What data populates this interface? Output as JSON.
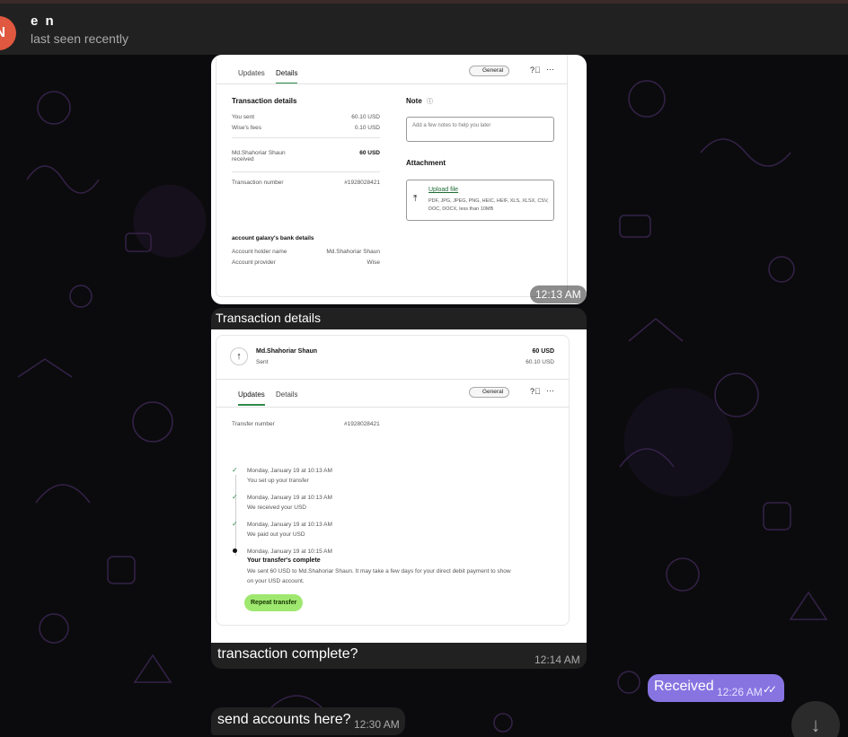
{
  "header": {
    "avatar_letter": "N",
    "peer_name": "e n",
    "status": "last seen recently"
  },
  "messages": [
    {
      "time": "12:13 AM",
      "screenshot": {
        "tabs": [
          "Updates",
          "Details"
        ],
        "active_tab": "Details",
        "dropdown": "General",
        "section_title": "Transaction details",
        "rows": [
          {
            "label": "You sent",
            "value": "60.10 USD"
          },
          {
            "label": "Wise's fees",
            "value": "0.10 USD"
          },
          {
            "label": "Md.Shahoriar Shaun received",
            "value": "60 USD"
          },
          {
            "label": "Transaction number",
            "value": "#1928028421"
          }
        ],
        "note_title": "Note",
        "note_placeholder": "Add a few notes to help you later",
        "attachment_title": "Attachment",
        "upload_label": "Upload file",
        "upload_hint": "PDF, JPG, JPEG, PNG, HEIC, HEIF, XLS, XLSX, CSV, DOC, DOCX, less than 10MB",
        "bank_title": "account galaxy's bank details",
        "bank_rows": [
          {
            "label": "Account holder name",
            "value": "Md.Shahoriar Shaun"
          },
          {
            "label": "Account provider",
            "value": "Wise"
          }
        ]
      }
    },
    {
      "caption": "Transaction details",
      "time": "12:14 AM",
      "text": "transaction complete?",
      "screenshot": {
        "recipient": "Md.Shahoriar Shaun",
        "recipient_sub": "Sent",
        "amount": "60 USD",
        "amount_sub": "60.10 USD",
        "tabs": [
          "Updates",
          "Details"
        ],
        "active_tab": "Updates",
        "dropdown": "General",
        "transfer_label": "Transfer number",
        "transfer_value": "#1928028421",
        "steps": [
          {
            "time": "Monday, January 19 at 10:13 AM",
            "text": "You set up your transfer"
          },
          {
            "time": "Monday, January 19 at 10:13 AM",
            "text": "We received your USD"
          },
          {
            "time": "Monday, January 19 at 10:13 AM",
            "text": "We paid out your USD"
          }
        ],
        "final_time": "Monday, January 19 at 10:15 AM",
        "final_title": "Your transfer's complete",
        "final_text_1": "We sent 60 USD to Md.Shahoriar Shaun. It may take a few days for your direct debit payment to show",
        "final_text_2": "on your USD account.",
        "repeat_button": "Repeat transfer"
      }
    },
    {
      "direction": "out",
      "text": "Received",
      "time": "12:26 AM",
      "checks": "✓✓"
    },
    {
      "direction": "in",
      "text": "send accounts here?",
      "time": "12:30 AM"
    }
  ],
  "scroll_down_icon": "arrow-down-icon",
  "colors": {
    "accent_out": "#8774e1",
    "avatar": "#e0583f",
    "wise_green": "#9fe870"
  }
}
